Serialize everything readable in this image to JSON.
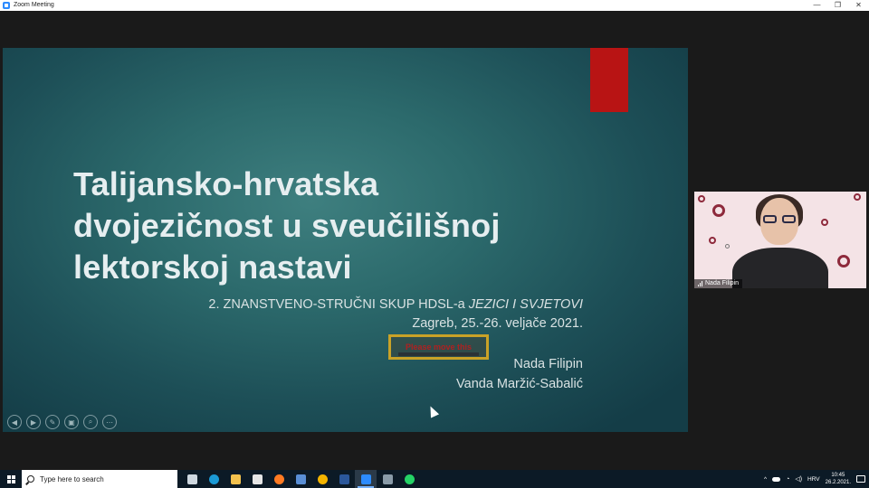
{
  "window": {
    "title": "Zoom Meeting",
    "minimize": "—",
    "restore": "❐",
    "close": "✕"
  },
  "slide": {
    "title_lines": [
      "Talijansko-hrvatska",
      "dvojezičnost u sveučilišnoj",
      "lektorskoj nastavi"
    ],
    "subtitle_prefix": "2. ZNANSTVENO-STRUČNI SKUP HDSL-a ",
    "subtitle_italic": "JEZICI I SVJETOVI",
    "date": "Zagreb, 25.-26. veljače 2021.",
    "note": "Please move this",
    "author1": "Nada Filipin",
    "author2": "Vanda Maržić-Sabalić",
    "controls": [
      "◀",
      "▶",
      "✎",
      "▣",
      "⌕",
      "⋯"
    ],
    "accent_color": "#b81414"
  },
  "video": {
    "participant_name": "Nada Filipin"
  },
  "taskbar": {
    "search_placeholder": "Type here to search",
    "apps": [
      {
        "name": "task-view",
        "color": "#cfd8e0"
      },
      {
        "name": "edge",
        "color": "#1b9ad6"
      },
      {
        "name": "file-explorer",
        "color": "#f2c14e"
      },
      {
        "name": "store",
        "color": "#e6e6e6"
      },
      {
        "name": "firefox",
        "color": "#ff7a22"
      },
      {
        "name": "thunderbird",
        "color": "#5a8fd6"
      },
      {
        "name": "chrome",
        "color": "#f4b400"
      },
      {
        "name": "word",
        "color": "#2b579a"
      },
      {
        "name": "zoom",
        "color": "#2d8cff"
      },
      {
        "name": "calculator",
        "color": "#8a9ba8"
      },
      {
        "name": "whatsapp",
        "color": "#25d366"
      }
    ],
    "tray_chevron": "^",
    "language": "HRV",
    "time": "10:45",
    "date": "26.2.2021."
  }
}
